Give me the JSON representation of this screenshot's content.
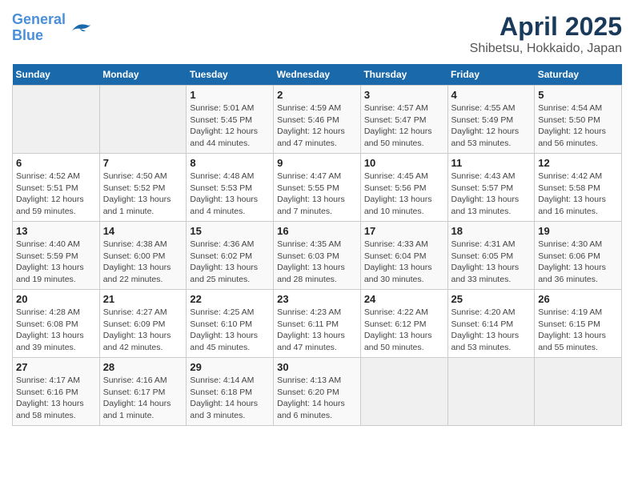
{
  "header": {
    "logo_line1": "General",
    "logo_line2": "Blue",
    "month": "April 2025",
    "location": "Shibetsu, Hokkaido, Japan"
  },
  "weekdays": [
    "Sunday",
    "Monday",
    "Tuesday",
    "Wednesday",
    "Thursday",
    "Friday",
    "Saturday"
  ],
  "weeks": [
    [
      {
        "day": "",
        "info": ""
      },
      {
        "day": "",
        "info": ""
      },
      {
        "day": "1",
        "info": "Sunrise: 5:01 AM\nSunset: 5:45 PM\nDaylight: 12 hours and 44 minutes."
      },
      {
        "day": "2",
        "info": "Sunrise: 4:59 AM\nSunset: 5:46 PM\nDaylight: 12 hours and 47 minutes."
      },
      {
        "day": "3",
        "info": "Sunrise: 4:57 AM\nSunset: 5:47 PM\nDaylight: 12 hours and 50 minutes."
      },
      {
        "day": "4",
        "info": "Sunrise: 4:55 AM\nSunset: 5:49 PM\nDaylight: 12 hours and 53 minutes."
      },
      {
        "day": "5",
        "info": "Sunrise: 4:54 AM\nSunset: 5:50 PM\nDaylight: 12 hours and 56 minutes."
      }
    ],
    [
      {
        "day": "6",
        "info": "Sunrise: 4:52 AM\nSunset: 5:51 PM\nDaylight: 12 hours and 59 minutes."
      },
      {
        "day": "7",
        "info": "Sunrise: 4:50 AM\nSunset: 5:52 PM\nDaylight: 13 hours and 1 minute."
      },
      {
        "day": "8",
        "info": "Sunrise: 4:48 AM\nSunset: 5:53 PM\nDaylight: 13 hours and 4 minutes."
      },
      {
        "day": "9",
        "info": "Sunrise: 4:47 AM\nSunset: 5:55 PM\nDaylight: 13 hours and 7 minutes."
      },
      {
        "day": "10",
        "info": "Sunrise: 4:45 AM\nSunset: 5:56 PM\nDaylight: 13 hours and 10 minutes."
      },
      {
        "day": "11",
        "info": "Sunrise: 4:43 AM\nSunset: 5:57 PM\nDaylight: 13 hours and 13 minutes."
      },
      {
        "day": "12",
        "info": "Sunrise: 4:42 AM\nSunset: 5:58 PM\nDaylight: 13 hours and 16 minutes."
      }
    ],
    [
      {
        "day": "13",
        "info": "Sunrise: 4:40 AM\nSunset: 5:59 PM\nDaylight: 13 hours and 19 minutes."
      },
      {
        "day": "14",
        "info": "Sunrise: 4:38 AM\nSunset: 6:00 PM\nDaylight: 13 hours and 22 minutes."
      },
      {
        "day": "15",
        "info": "Sunrise: 4:36 AM\nSunset: 6:02 PM\nDaylight: 13 hours and 25 minutes."
      },
      {
        "day": "16",
        "info": "Sunrise: 4:35 AM\nSunset: 6:03 PM\nDaylight: 13 hours and 28 minutes."
      },
      {
        "day": "17",
        "info": "Sunrise: 4:33 AM\nSunset: 6:04 PM\nDaylight: 13 hours and 30 minutes."
      },
      {
        "day": "18",
        "info": "Sunrise: 4:31 AM\nSunset: 6:05 PM\nDaylight: 13 hours and 33 minutes."
      },
      {
        "day": "19",
        "info": "Sunrise: 4:30 AM\nSunset: 6:06 PM\nDaylight: 13 hours and 36 minutes."
      }
    ],
    [
      {
        "day": "20",
        "info": "Sunrise: 4:28 AM\nSunset: 6:08 PM\nDaylight: 13 hours and 39 minutes."
      },
      {
        "day": "21",
        "info": "Sunrise: 4:27 AM\nSunset: 6:09 PM\nDaylight: 13 hours and 42 minutes."
      },
      {
        "day": "22",
        "info": "Sunrise: 4:25 AM\nSunset: 6:10 PM\nDaylight: 13 hours and 45 minutes."
      },
      {
        "day": "23",
        "info": "Sunrise: 4:23 AM\nSunset: 6:11 PM\nDaylight: 13 hours and 47 minutes."
      },
      {
        "day": "24",
        "info": "Sunrise: 4:22 AM\nSunset: 6:12 PM\nDaylight: 13 hours and 50 minutes."
      },
      {
        "day": "25",
        "info": "Sunrise: 4:20 AM\nSunset: 6:14 PM\nDaylight: 13 hours and 53 minutes."
      },
      {
        "day": "26",
        "info": "Sunrise: 4:19 AM\nSunset: 6:15 PM\nDaylight: 13 hours and 55 minutes."
      }
    ],
    [
      {
        "day": "27",
        "info": "Sunrise: 4:17 AM\nSunset: 6:16 PM\nDaylight: 13 hours and 58 minutes."
      },
      {
        "day": "28",
        "info": "Sunrise: 4:16 AM\nSunset: 6:17 PM\nDaylight: 14 hours and 1 minute."
      },
      {
        "day": "29",
        "info": "Sunrise: 4:14 AM\nSunset: 6:18 PM\nDaylight: 14 hours and 3 minutes."
      },
      {
        "day": "30",
        "info": "Sunrise: 4:13 AM\nSunset: 6:20 PM\nDaylight: 14 hours and 6 minutes."
      },
      {
        "day": "",
        "info": ""
      },
      {
        "day": "",
        "info": ""
      },
      {
        "day": "",
        "info": ""
      }
    ]
  ]
}
